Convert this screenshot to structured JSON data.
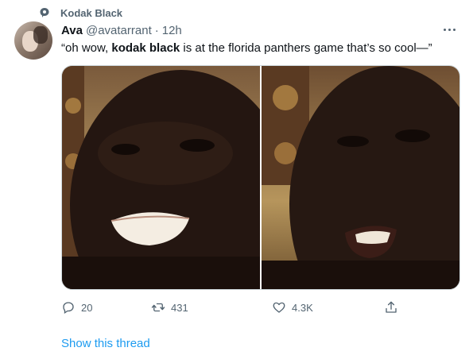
{
  "topic": {
    "label": "Kodak Black",
    "icon": "topic-icon"
  },
  "tweet": {
    "author_name": "Ava",
    "author_handle": "@avatarrant",
    "separator": "·",
    "timestamp": "12h",
    "text_before": "“oh wow, ",
    "text_bold": "kodak black",
    "text_after": " is at the florida panthers game that’s so cool—”"
  },
  "actions": {
    "reply_count": "20",
    "retweet_count": "431",
    "like_count": "4.3K"
  },
  "show_thread_label": "Show this thread",
  "colors": {
    "accent": "#1d9bf0",
    "muted": "#536471",
    "text": "#0f1419"
  }
}
